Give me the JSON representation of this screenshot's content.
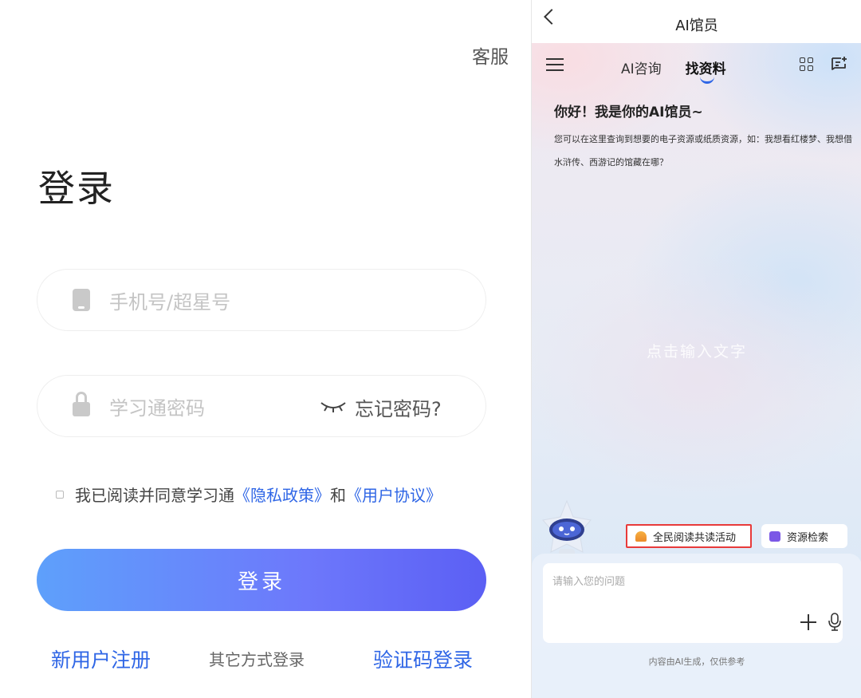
{
  "login": {
    "service_label": "客服",
    "title": "登录",
    "phone_placeholder": "手机号/超星号",
    "password_placeholder": "学习通密码",
    "forgot_label": "忘记密码?",
    "agree_prefix": "我已阅读并同意学习通",
    "privacy_link": "《隐私政策》",
    "agree_and": "和",
    "terms_link": "《用户协议》",
    "login_button": "登录",
    "register_link": "新用户注册",
    "other_login": "其它方式登录",
    "sms_login": "验证码登录",
    "accent_color": "#2f66e6"
  },
  "ai": {
    "window_title": "AI馆员",
    "tabs": [
      {
        "label": "AI咨询",
        "active": false
      },
      {
        "label": "找资料",
        "active": true
      }
    ],
    "greeting": "你好！我是你的AI馆员~",
    "description": "您可以在这里查询到想要的电子资源或纸质资源，如：我想看红楼梦、我想借水浒传、西游记的馆藏在哪？",
    "tap_to_input": "点击输入文字",
    "chips": [
      {
        "label": "全民阅读共读活动",
        "icon": "reading-icon",
        "highlighted": true
      },
      {
        "label": "资源检索",
        "icon": "resource-search-icon",
        "highlighted": false
      }
    ],
    "input_placeholder": "请输入您的问题",
    "disclaimer": "内容由AI生成，仅供参考",
    "highlight_color": "#e83a3a"
  }
}
